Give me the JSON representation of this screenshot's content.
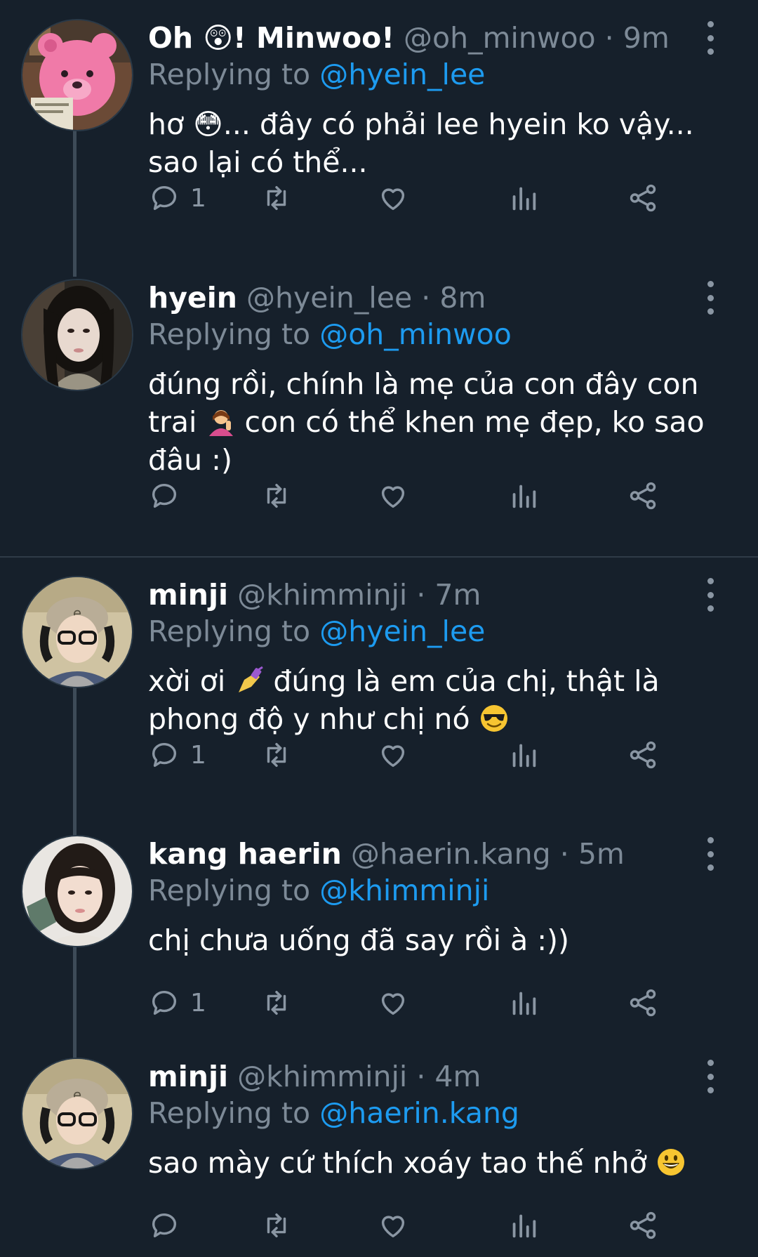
{
  "tweets": [
    {
      "name": "Oh 😲! Minwoo!",
      "handle": "@oh_minwoo",
      "sep": "·",
      "time": "9m",
      "replying_prefix": "Replying to",
      "replying_to": "@hyein_lee",
      "text_line1": "hơ 😳... đây có phải lee hyein ko vậy...",
      "text_line2": "sao lại có thể...",
      "reply_count": "1",
      "avatar": "pink-plush-bear-avatar"
    },
    {
      "name": "hyein",
      "handle": "@hyein_lee",
      "sep": "·",
      "time": "8m",
      "replying_prefix": "Replying to",
      "replying_to": "@oh_minwoo",
      "text_line1": "đúng rồi, chính là mẹ của con đây con",
      "text_line2_a": "trai",
      "text_line2_b": "con có thể khen mẹ đẹp, ko sao",
      "text_line3": "đâu :)",
      "reply_count": "",
      "avatar": "woman-dark-hair-avatar"
    },
    {
      "name": "minji",
      "handle": "@khimminji",
      "sep": "·",
      "time": "7m",
      "replying_prefix": "Replying to",
      "replying_to": "@hyein_lee",
      "text_line1_a": "xời ơi",
      "text_line1_b": "đúng là em của chị, thật là",
      "text_line2_a": "phong độ y như chị nó",
      "reply_count": "1",
      "avatar": "woman-headphones-beanie-avatar"
    },
    {
      "name": "kang haerin",
      "handle": "@haerin.kang",
      "sep": "·",
      "time": "5m",
      "replying_prefix": "Replying to",
      "replying_to": "@khimminji",
      "text_line1": "chị chưa uống đã say rồi à :))",
      "reply_count": "1",
      "avatar": "woman-bangs-avatar"
    },
    {
      "name": "minji",
      "handle": "@khimminji",
      "sep": "·",
      "time": "4m",
      "replying_prefix": "Replying to",
      "replying_to": "@haerin.kang",
      "text_line1_a": "sao mày cứ thích xoáy tao thế nhở",
      "reply_count": "",
      "avatar": "woman-headphones-beanie-avatar"
    }
  ],
  "colors": {
    "background": "#16202b",
    "mention": "#1d9bf0",
    "muted": "#7d8a97"
  },
  "icons": [
    "reply-icon",
    "retweet-icon",
    "like-icon",
    "views-icon",
    "share-icon",
    "more-options-icon"
  ]
}
